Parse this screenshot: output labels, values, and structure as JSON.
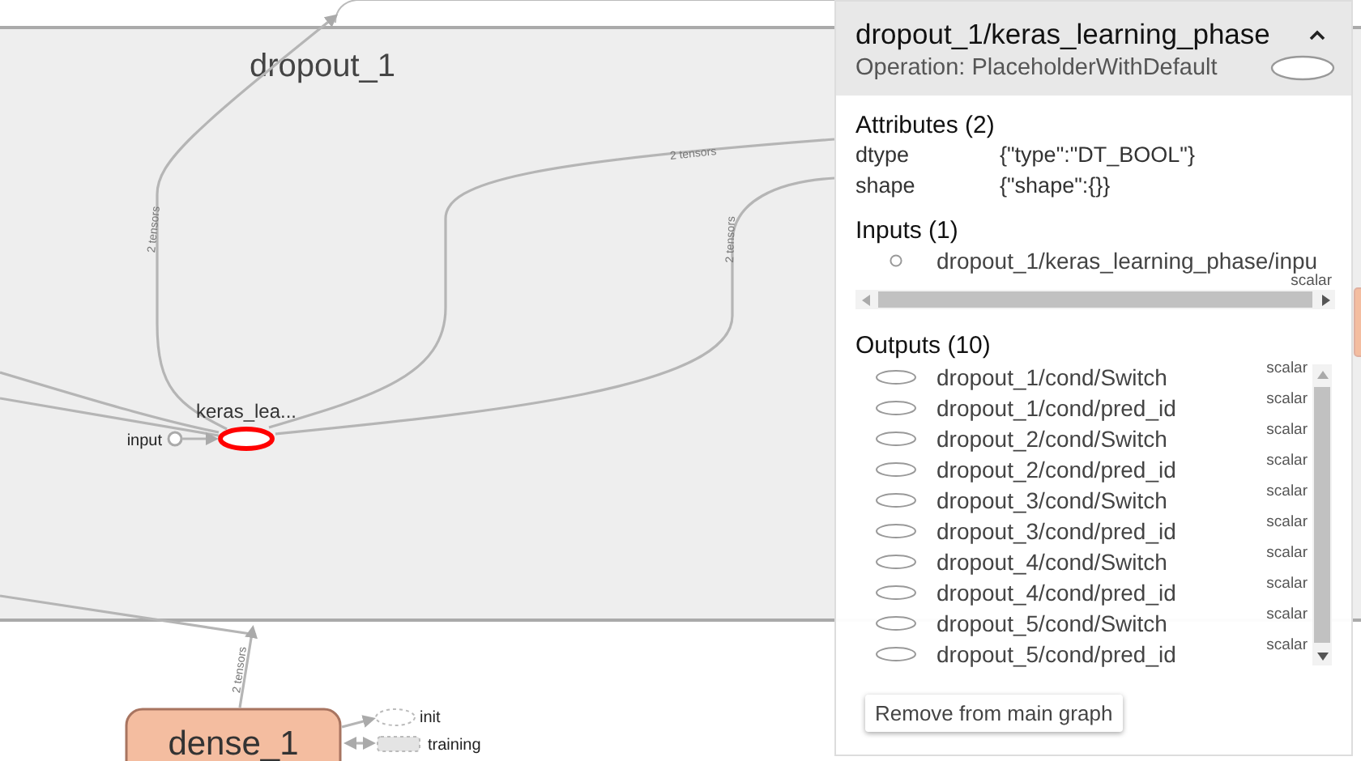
{
  "graph": {
    "group_title": "dropout_1",
    "nodes": [
      {
        "kind": "op",
        "label": "keras_lea...",
        "selected": true
      },
      {
        "kind": "input",
        "label": "input",
        "selected": false
      },
      {
        "kind": "meta",
        "label": "dense_1",
        "selected": false
      },
      {
        "kind": "dashed-ellipse",
        "label": "init",
        "selected": false
      },
      {
        "kind": "dashed-rect",
        "label": "training",
        "selected": false
      }
    ],
    "edge_labels": [
      "2 tensors",
      "2 tensors",
      "2 tensors",
      "2 tensors"
    ]
  },
  "panel": {
    "title": "dropout_1/keras_learning_phase",
    "subtitle": "Operation: PlaceholderWithDefault",
    "attributes": {
      "heading": "Attributes (2)",
      "rows": [
        {
          "key": "dtype",
          "value": "{\"type\":\"DT_BOOL\"}"
        },
        {
          "key": "shape",
          "value": "{\"shape\":{}}"
        }
      ]
    },
    "inputs": {
      "heading": "Inputs (1)",
      "rows": [
        {
          "kind": "constant",
          "name": "dropout_1/keras_learning_phase/inpu",
          "shape": "scalar"
        }
      ]
    },
    "outputs": {
      "heading": "Outputs (10)",
      "rows": [
        {
          "kind": "op",
          "name": "dropout_1/cond/Switch",
          "shape": "scalar"
        },
        {
          "kind": "op",
          "name": "dropout_1/cond/pred_id",
          "shape": "scalar"
        },
        {
          "kind": "op",
          "name": "dropout_2/cond/Switch",
          "shape": "scalar"
        },
        {
          "kind": "op",
          "name": "dropout_2/cond/pred_id",
          "shape": "scalar"
        },
        {
          "kind": "op",
          "name": "dropout_3/cond/Switch",
          "shape": "scalar"
        },
        {
          "kind": "op",
          "name": "dropout_3/cond/pred_id",
          "shape": "scalar"
        },
        {
          "kind": "op",
          "name": "dropout_4/cond/Switch",
          "shape": "scalar"
        },
        {
          "kind": "op",
          "name": "dropout_4/cond/pred_id",
          "shape": "scalar"
        },
        {
          "kind": "op",
          "name": "dropout_5/cond/Switch",
          "shape": "scalar"
        },
        {
          "kind": "op",
          "name": "dropout_5/cond/pred_id",
          "shape": "scalar"
        }
      ]
    },
    "button": "Remove from main graph"
  }
}
